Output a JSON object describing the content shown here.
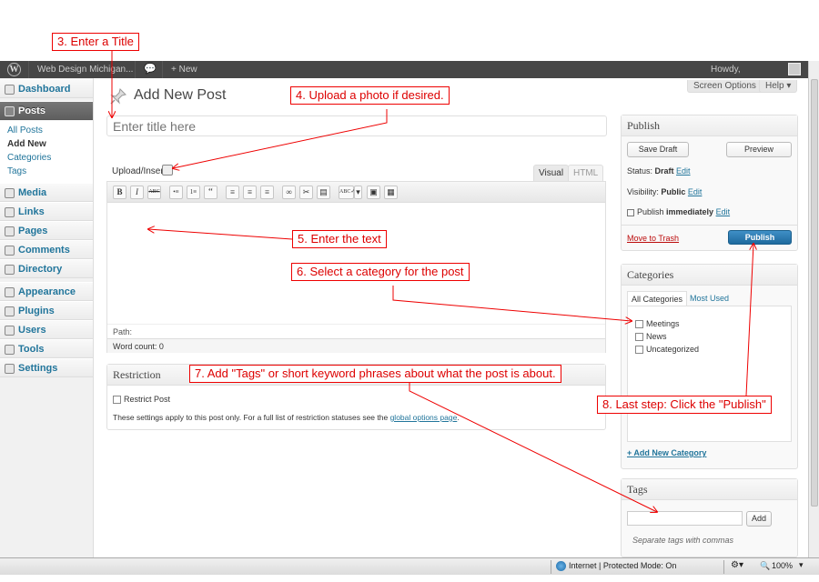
{
  "admin_bar": {
    "site_name": "Web Design Michigan...",
    "new_label": "+ New",
    "howdy": "Howdy,"
  },
  "screen_options": {
    "screen_options_label": "Screen Options ▾",
    "help_label": "Help ▾"
  },
  "sidebar": {
    "items": [
      {
        "label": "Dashboard"
      },
      {
        "label": "Posts"
      },
      {
        "label": "Media"
      },
      {
        "label": "Links"
      },
      {
        "label": "Pages"
      },
      {
        "label": "Comments"
      },
      {
        "label": "Directory"
      },
      {
        "label": "Appearance"
      },
      {
        "label": "Plugins"
      },
      {
        "label": "Users"
      },
      {
        "label": "Tools"
      },
      {
        "label": "Settings"
      }
    ],
    "posts_submenu": [
      "All Posts",
      "Add New",
      "Categories",
      "Tags"
    ]
  },
  "page": {
    "title": "Add New Post",
    "title_placeholder": "Enter title here"
  },
  "editor": {
    "upload_label": "Upload/Insert",
    "tab_visual": "Visual",
    "tab_html": "HTML",
    "toolbar_buttons": [
      "B",
      "I",
      "ABC",
      "•≡",
      "1≡",
      "“",
      "≡",
      "≡",
      "≡",
      "∞",
      "✂",
      "▤",
      "ABC✓",
      "▾",
      "▣",
      "▦"
    ],
    "path_label": "Path:",
    "word_count": "Word count: 0"
  },
  "restriction": {
    "title": "Restriction",
    "checkbox_label": "Restrict Post",
    "note_prefix": "These settings apply to this post only. For a full list of restriction statuses see the ",
    "note_link": "global options page",
    "note_suffix": "."
  },
  "publish": {
    "title": "Publish",
    "save_draft": "Save Draft",
    "preview": "Preview",
    "status_label": "Status: ",
    "status_value": "Draft",
    "visibility_label": "Visibility: ",
    "visibility_value": "Public",
    "publish_label": "Publish ",
    "publish_value": "immediately",
    "edit": "Edit",
    "move_to_trash": "Move to Trash",
    "publish_button": "Publish"
  },
  "categories": {
    "title": "Categories",
    "tab_all": "All Categories",
    "tab_most_used": "Most Used",
    "items": [
      "Meetings",
      "News",
      "Uncategorized"
    ],
    "add_new": "+ Add New Category"
  },
  "tags": {
    "title": "Tags",
    "add_button": "Add",
    "note": "Separate tags with commas"
  },
  "status_bar": {
    "zone": "Internet | Protected Mode: On",
    "zoom": "100%"
  },
  "annotations": {
    "step3": "3.  Enter a Title",
    "step4": "4.  Upload a photo if desired.",
    "step5": "5.  Enter the text",
    "step6": "6.  Select a category for the post",
    "step7": "7.  Add \"Tags\" or short keyword phrases about what the post is about.",
    "step8": "8.  Last step:  Click the \"Publish\""
  },
  "colors": {
    "link": "#21759b",
    "annotation": "#dd0000",
    "publish_button": "#21759b",
    "admin_bar": "#464646"
  }
}
